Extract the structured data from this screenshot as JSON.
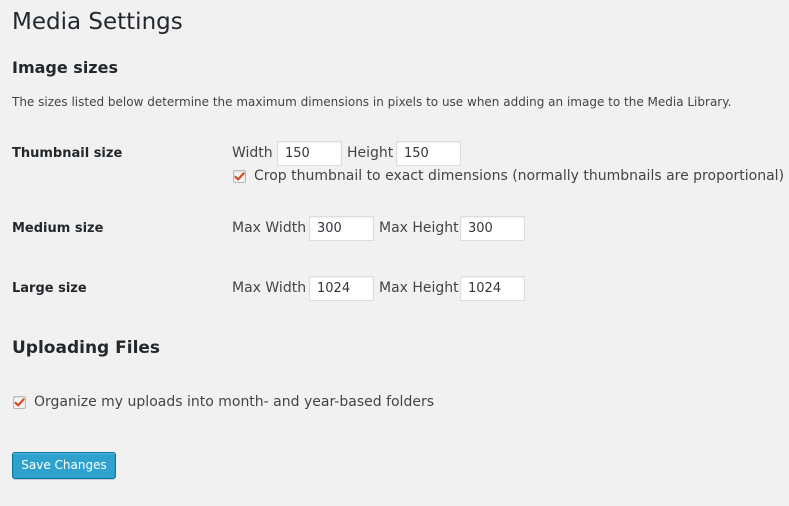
{
  "page": {
    "title": "Media Settings"
  },
  "image_sizes": {
    "heading": "Image sizes",
    "description": "The sizes listed below determine the maximum dimensions in pixels to use when adding an image to the Media Library.",
    "thumbnail": {
      "label": "Thumbnail size",
      "width_label": "Width",
      "width_value": "150",
      "height_label": "Height",
      "height_value": "150",
      "crop_checked": true,
      "crop_label": "Crop thumbnail to exact dimensions (normally thumbnails are proportional)"
    },
    "medium": {
      "label": "Medium size",
      "width_label": "Max Width",
      "width_value": "300",
      "height_label": "Max Height",
      "height_value": "300"
    },
    "large": {
      "label": "Large size",
      "width_label": "Max Width",
      "width_value": "1024",
      "height_label": "Max Height",
      "height_value": "1024"
    }
  },
  "uploading": {
    "heading": "Uploading Files",
    "organize_checked": true,
    "organize_label": "Organize my uploads into month- and year-based folders"
  },
  "actions": {
    "save_label": "Save Changes"
  },
  "colors": {
    "accent": "#2ea2cc",
    "checkmark": "#d54e21",
    "background": "#f1f1f1"
  },
  "icons": {
    "checkbox_check": "checkmark-icon"
  }
}
